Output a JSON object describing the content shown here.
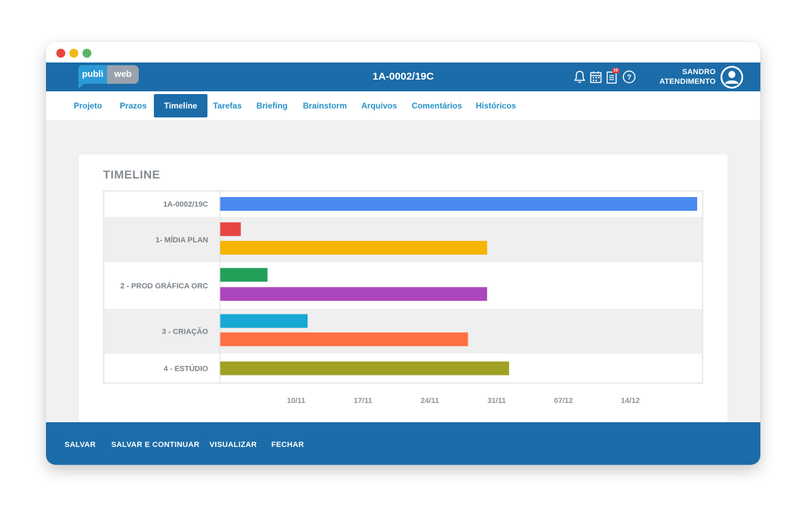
{
  "window": {
    "controls": [
      "close",
      "minimize",
      "zoom"
    ]
  },
  "header": {
    "logo_left": "publi",
    "logo_right": "web",
    "title": "1A-0002/19C",
    "icons": [
      "bell-icon",
      "calendar-icon",
      "document-icon",
      "help-icon"
    ],
    "badge": "10",
    "help_glyph": "?",
    "user_line1": "SANDRO",
    "user_line2": "ATENDIMENTO"
  },
  "tabs": [
    {
      "label": "Projeto",
      "active": false
    },
    {
      "label": "Prazos",
      "active": false
    },
    {
      "label": "Timeline",
      "active": true
    },
    {
      "label": "Tarefas",
      "active": false
    },
    {
      "label": "Briefing",
      "active": false
    },
    {
      "label": "Brainstorm",
      "active": false
    },
    {
      "label": "Arquivos",
      "active": false
    },
    {
      "label": "Comentários",
      "active": false
    },
    {
      "label": "Históricos",
      "active": false
    }
  ],
  "card": {
    "title": "TIMELINE"
  },
  "chart_data": {
    "type": "bar",
    "orientation": "horizontal-timeline",
    "x_ticks": [
      "10/11",
      "17/11",
      "24/11",
      "31/11",
      "07/12",
      "14/12"
    ],
    "xlim": [
      0,
      50
    ],
    "tick_positions": [
      8,
      15,
      22,
      29,
      36,
      43
    ],
    "rows": [
      {
        "label": "1A-0002/19C",
        "bars": [
          {
            "start": 0,
            "end": 50,
            "color": "#4a8af0"
          }
        ]
      },
      {
        "label": "1- MÍDIA PLAN",
        "bars": [
          {
            "start": 0,
            "end": 2.2,
            "color": "#e64545"
          },
          {
            "start": 0,
            "end": 28,
            "color": "#f4b400"
          }
        ]
      },
      {
        "label": "2 - PROD GRÁFICA ORC",
        "bars": [
          {
            "start": 0,
            "end": 5,
            "color": "#22a05a"
          },
          {
            "start": 0,
            "end": 28,
            "color": "#ab47bc"
          }
        ]
      },
      {
        "label": "3 - CRIAÇÃO",
        "bars": [
          {
            "start": 0,
            "end": 9.2,
            "color": "#17a9d4"
          },
          {
            "start": 0,
            "end": 26,
            "color": "#ff7043"
          }
        ]
      },
      {
        "label": "4 - ESTÚDIO",
        "bars": [
          {
            "start": 0,
            "end": 30.3,
            "color": "#a0a024"
          }
        ]
      }
    ]
  },
  "footer": {
    "buttons": [
      "SALVAR",
      "SALVAR E CONTINUAR",
      "VISUALIZAR",
      "FECHAR"
    ]
  },
  "colors": {
    "primary": "#1b6ca8",
    "tab_text": "#2790c8",
    "logo_blue": "#2d9ad8",
    "logo_gray": "#9aa3ad",
    "content_bg": "#f1f1f1",
    "row_alt": "#efefef"
  }
}
